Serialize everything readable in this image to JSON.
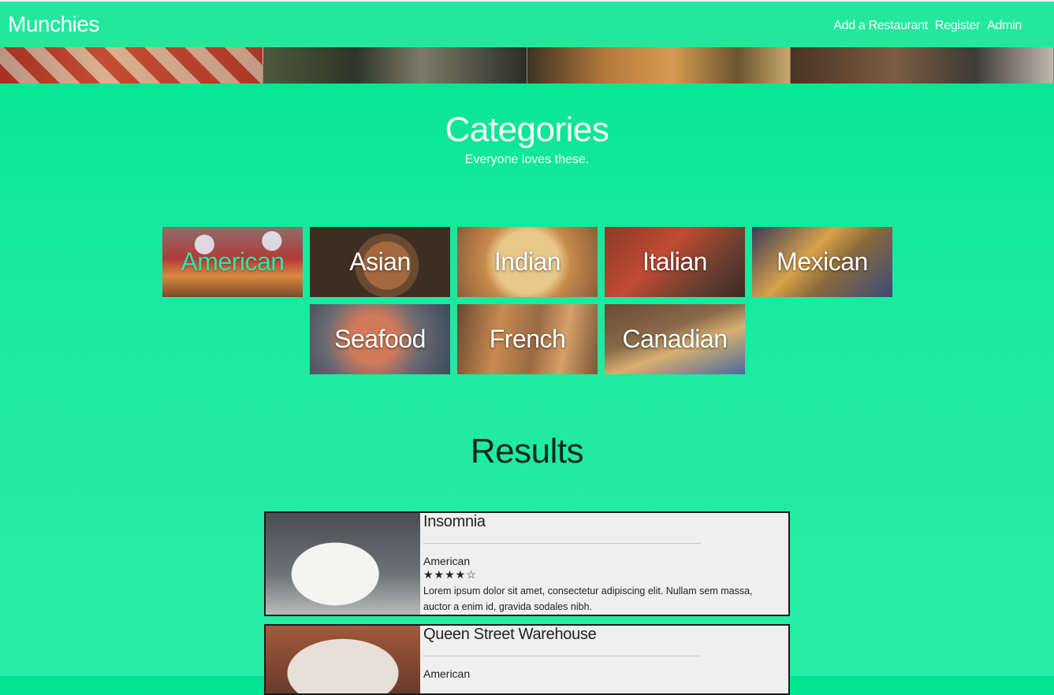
{
  "nav": {
    "brand": "Munchies",
    "links": [
      "Add a Restaurant",
      "Register",
      "Admin"
    ]
  },
  "categories": {
    "title": "Categories",
    "subtitle": "Everyone loves these.",
    "items": [
      "American",
      "Asian",
      "Indian",
      "Italian",
      "Mexican",
      "Seafood",
      "French",
      "Canadian"
    ],
    "active": "American"
  },
  "results": {
    "title": "Results",
    "items": [
      {
        "name": "Insomnia",
        "category": "American",
        "stars": "★★★★☆",
        "rating": 4,
        "description": "Lorem ipsum dolor sit amet, consectetur adipiscing elit. Nullam sem massa, auctor a enim id, gravida sodales nibh."
      },
      {
        "name": "Queen Street Warehouse",
        "category": "American",
        "stars": "",
        "description": ""
      }
    ]
  },
  "colors": {
    "background": "#00e690",
    "navbar": "#23e89b",
    "active_category": "#2ee6a4"
  }
}
